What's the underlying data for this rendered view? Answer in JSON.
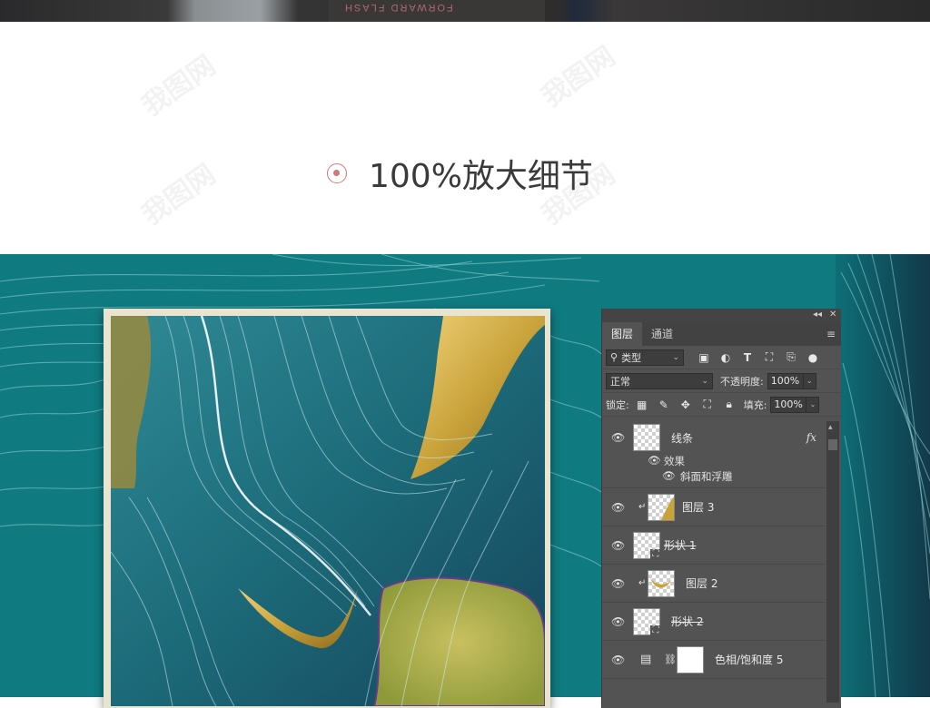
{
  "top_photo": {
    "book_text": "FORWARD\nFLASH"
  },
  "heading": {
    "text": "100%放大细节"
  },
  "watermark": {
    "text": "我图网"
  },
  "colors": {
    "accent": "#d2767a",
    "teal": "#0f7a80",
    "panel_bg": "#535353",
    "gold": "#c9a23a"
  },
  "photoshop": {
    "tabs": [
      {
        "label": "图层",
        "active": true
      },
      {
        "label": "通道",
        "active": false
      }
    ],
    "filter_kind": "类型",
    "blend_mode": "正常",
    "opacity_label": "不透明度:",
    "opacity_value": "100%",
    "lock_label": "锁定:",
    "fill_label": "填充:",
    "fill_value": "100%",
    "layers": [
      {
        "name": "线条",
        "fx": "fx",
        "sub": [
          "效果",
          "斜面和浮雕"
        ]
      },
      {
        "name": "图层 3"
      },
      {
        "name": "形状 1"
      },
      {
        "name": "图层 2"
      },
      {
        "name": "形状 2"
      },
      {
        "name": "色相/饱和度 5"
      }
    ],
    "icons": [
      "eye-icon",
      "image-filter-icon",
      "adjustment-filter-icon",
      "type-filter-icon",
      "shape-filter-icon",
      "smart-object-filter-icon",
      "toggle-filter-icon",
      "lock-pixels-icon",
      "lock-brush-icon",
      "lock-position-icon",
      "lock-artboard-icon",
      "lock-all-icon",
      "panel-menu-icon",
      "collapse-icon",
      "close-icon",
      "link-icon",
      "clip-arrow-icon"
    ]
  }
}
